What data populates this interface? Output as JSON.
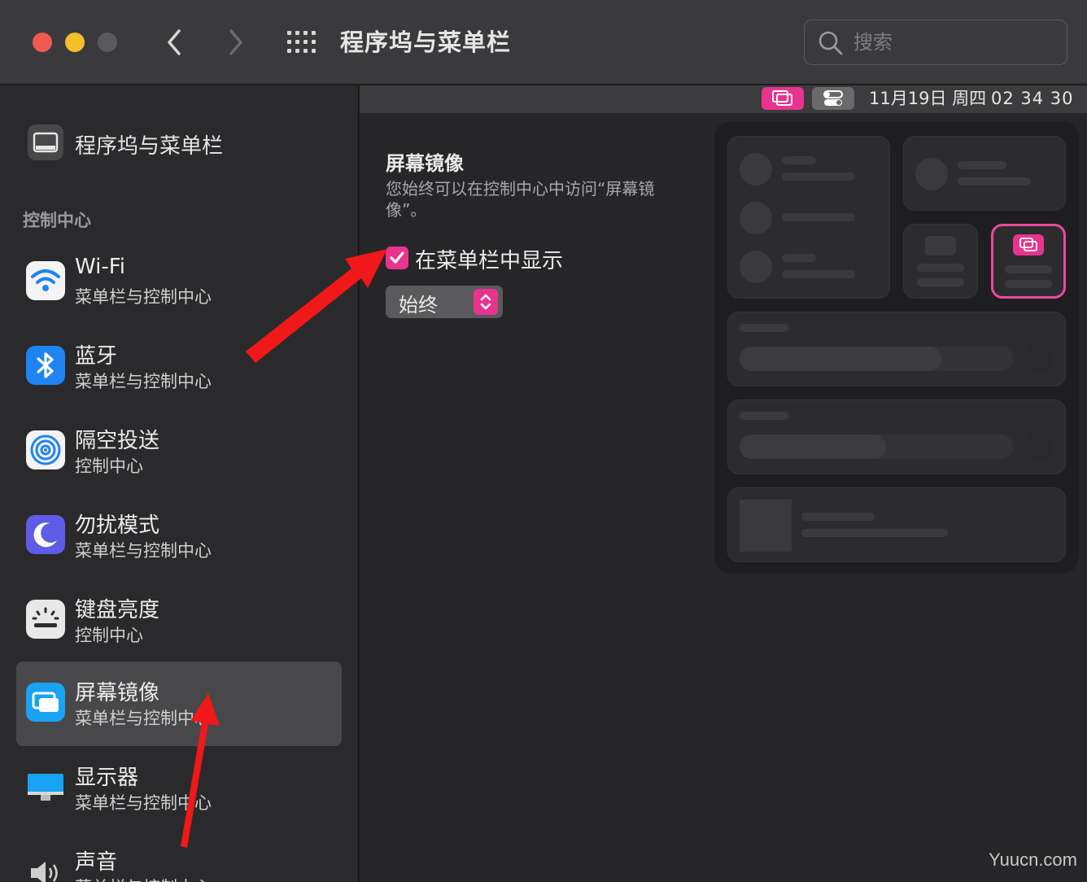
{
  "window": {
    "title": "程序坞与菜单栏"
  },
  "search": {
    "placeholder": "搜索"
  },
  "sidebar": {
    "top_item": {
      "label": "程序坞与菜单栏"
    },
    "section": "控制中心",
    "items": [
      {
        "title": "Wi-Fi",
        "subtitle": "菜单栏与控制中心",
        "icon": "wifi-icon"
      },
      {
        "title": "蓝牙",
        "subtitle": "菜单栏与控制中心",
        "icon": "bluetooth-icon"
      },
      {
        "title": "隔空投送",
        "subtitle": "控制中心",
        "icon": "airdrop-icon"
      },
      {
        "title": "勿扰模式",
        "subtitle": "菜单栏与控制中心",
        "icon": "moon-icon"
      },
      {
        "title": "键盘亮度",
        "subtitle": "控制中心",
        "icon": "keyboard-brightness-icon"
      },
      {
        "title": "屏幕镜像",
        "subtitle": "菜单栏与控制中心",
        "icon": "screen-mirroring-icon",
        "selected": true
      },
      {
        "title": "显示器",
        "subtitle": "菜单栏与控制中心",
        "icon": "display-icon"
      },
      {
        "title": "声音",
        "subtitle": "菜单栏与控制中心",
        "icon": "speaker-icon"
      }
    ]
  },
  "menubar": {
    "date": "11月19日 周四",
    "time": "02 34 30"
  },
  "detail": {
    "title": "屏幕镜像",
    "description": "您始终可以在控制中心中访问“屏幕镜像”。",
    "checkbox_label": "在菜单栏中显示",
    "checkbox_checked": true,
    "popup_value": "始终"
  },
  "colors": {
    "accent": "#e8348e",
    "sidebar_bg": "#2a2a2c",
    "main_bg": "#262628",
    "arrow": "#f01818"
  },
  "watermark": "Yuucn.com"
}
